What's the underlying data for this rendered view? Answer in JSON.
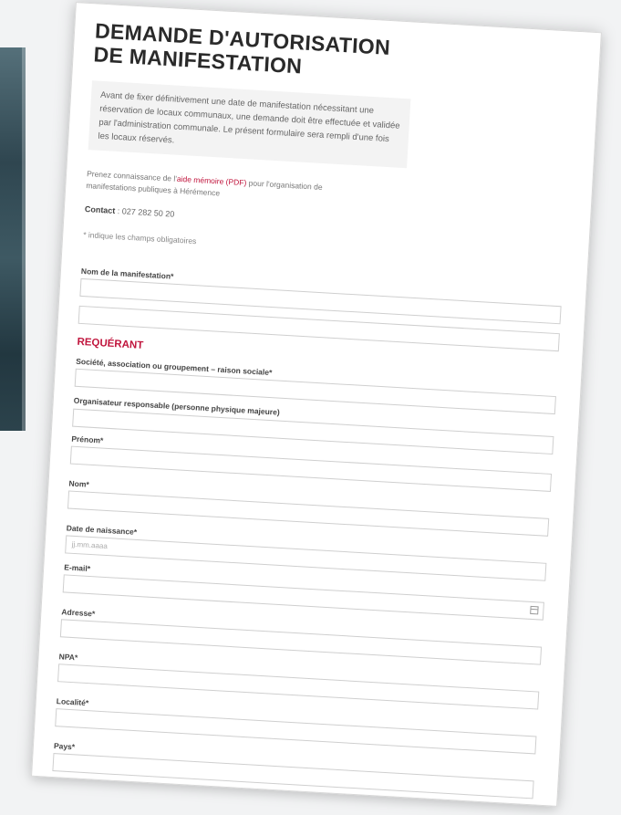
{
  "form": {
    "title": "DEMANDE D'AUTORISATION DE MANIFESTATION",
    "intro": "Avant de fixer définitivement une date de manifestation nécessitant une réservation de locaux communaux, une demande doit être effectuée et validée par l'administration communale. Le présent formulaire sera rempli d'une fois les locaux réservés.",
    "notice_before": "Prenez connaissance de l'",
    "notice_link": "aide mémoire (PDF)",
    "notice_after": " pour l'organisation de manifestations publiques à Hérémence",
    "contact_label": "Contact",
    "contact_value": " : 027 282 50 20",
    "required_note": "* indique les champs obligatoires",
    "event_name_label": "Nom de la manifestation*",
    "section_requerant": "REQUÉRANT",
    "company_label": "Société, association ou groupement – raison sociale*",
    "organizer_label": "Organisateur responsable (personne physique majeure)",
    "firstname_label": "Prénom*",
    "lastname_label": "Nom*",
    "birthdate_label": "Date de naissance*",
    "birthdate_placeholder": "jj.mm.aaaa",
    "email_label": "E-mail*",
    "address_label": "Adresse*",
    "npa_label": "NPA*",
    "locality_label": "Localité*",
    "country_label": "Pays*"
  },
  "colors": {
    "accent": "#c0143c",
    "text": "#444444",
    "intro_bg": "#f3f3f3"
  },
  "icons": {
    "date_picker": "calendar-icon"
  }
}
